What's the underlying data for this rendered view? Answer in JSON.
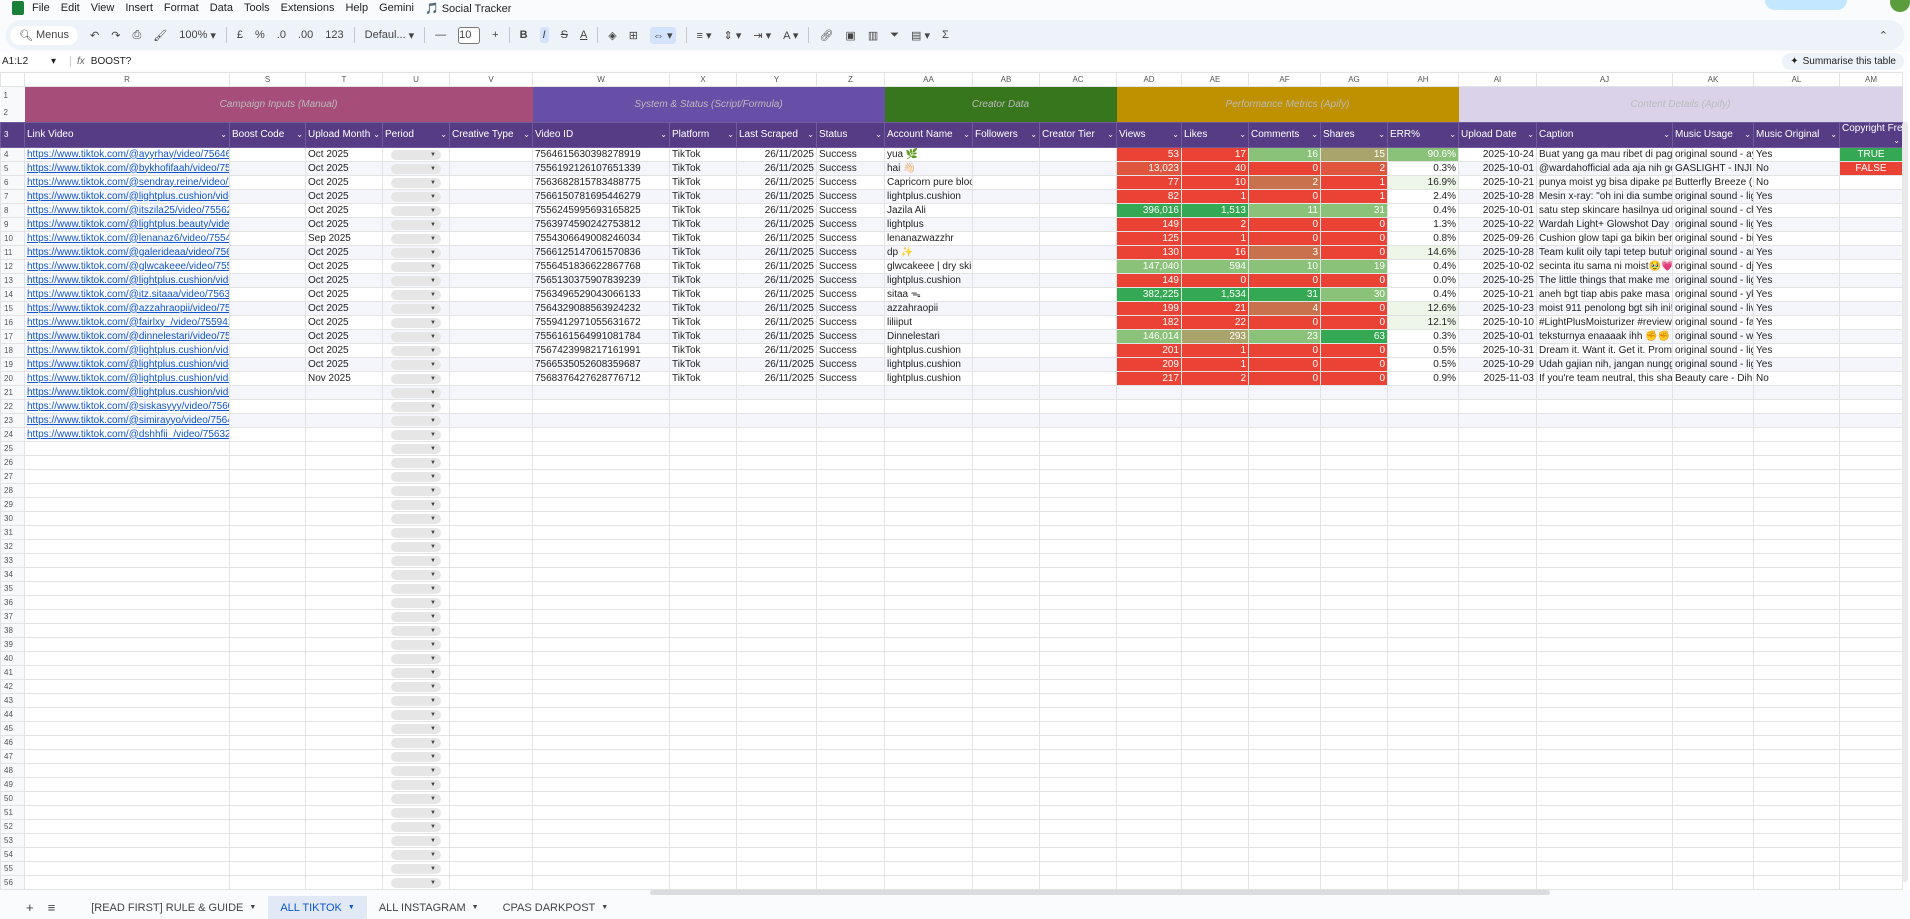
{
  "menu": [
    "File",
    "Edit",
    "View",
    "Insert",
    "Format",
    "Data",
    "Tools",
    "Extensions",
    "Help",
    "Gemini"
  ],
  "extension_menu": "🎵 Social Tracker",
  "toolbar": {
    "menus": "Menus",
    "zoom": "100%",
    "currency": "£",
    "percent": "%",
    "dec_less": ".0",
    "dec_more": ".00",
    "number_format": "123",
    "font": "Defaul...",
    "font_size": "10",
    "bold": "B",
    "italic": "I",
    "strike": "S",
    "text_color": "A",
    "sum": "Σ"
  },
  "formula": {
    "name_box": "A1:L2",
    "fx": "fx",
    "value": "BOOST?",
    "summarise": "Summarise this table"
  },
  "columns": [
    "R",
    "S",
    "T",
    "U",
    "V",
    "W",
    "X",
    "Y",
    "Z",
    "AA",
    "AB",
    "AC",
    "AD",
    "AE",
    "AF",
    "AG",
    "AH",
    "AI",
    "AJ",
    "AK",
    "AL",
    "AM"
  ],
  "bands": [
    {
      "label": "Campaign Inputs (Manual)",
      "color": "#a64d79",
      "span": 5
    },
    {
      "label": "System & Status (Script/Formula)",
      "color": "#674ea7",
      "span": 4
    },
    {
      "label": "Creator Data",
      "color": "#38761d",
      "span": 3
    },
    {
      "label": "Performance Metrics (Apify)",
      "color": "#bf9000",
      "span": 5
    },
    {
      "label": "Content Details (Apify)",
      "color": "#d9d2e9",
      "span": 5
    }
  ],
  "headers": [
    "Link Video",
    "Boost Code",
    "Upload Month",
    "Period",
    "Creative Type",
    "Video ID",
    "Platform",
    "Last Scraped",
    "Status",
    "Account Name",
    "Followers",
    "Creator Tier",
    "Views",
    "Likes",
    "Comments",
    "Shares",
    "ERR%",
    "Upload Date",
    "Caption",
    "Music Usage",
    "Music Original",
    "Copyright Free?"
  ],
  "scale_colors": {
    "R": "#ea4335",
    "O": "#e0553e",
    "B": "#c9714c",
    "OL": "#a8a46c",
    "LG": "#8bc27a",
    "G": "#34a853",
    "T": "#eef6ea",
    "W": "#ffffff"
  },
  "bool_colors": {
    "TRUE": "#34a853",
    "FALSE": "#ea4335"
  },
  "rows": [
    {
      "n": 4,
      "link": "https://www.tiktok.com/@ayyrhay/video/7564615",
      "month": "Oct 2025",
      "id": "7564615630398278919",
      "platform": "TikTok",
      "scraped": "26/11/2025",
      "status": "Success",
      "account": "yua 🌿",
      "views": "53",
      "likes": "17",
      "comments": "16",
      "shares": "15",
      "err": "90.6%",
      "c": [
        "R",
        "R",
        "LG",
        "OL",
        "LG"
      ],
      "date": "2025-10-24",
      "caption": "Buat yang ga mau ribet di pagi har",
      "music": "original sound - ayyr",
      "orig": "Yes",
      "copy": "TRUE"
    },
    {
      "n": 5,
      "link": "https://www.tiktok.com/@bykhofifaah/video/7556",
      "month": "Oct 2025",
      "id": "7556192126107651339",
      "platform": "TikTok",
      "scraped": "26/11/2025",
      "status": "Success",
      "account": "hai 👋🏻",
      "views": "13,023",
      "likes": "40",
      "comments": "0",
      "shares": "2",
      "err": "0.3%",
      "c": [
        "O",
        "R",
        "R",
        "O",
        "W"
      ],
      "date": "2025-10-01",
      "caption": "@wardahofficial ada aja nih gebra",
      "music": "GASLIGHT - INJI",
      "orig": "No",
      "copy": "FALSE"
    },
    {
      "n": 6,
      "link": "https://www.tiktok.com/@sendray.reine/video/756",
      "month": "Oct 2025",
      "id": "7563682815783488775",
      "platform": "TikTok",
      "scraped": "26/11/2025",
      "status": "Success",
      "account": "Capricorn pure blood",
      "views": "77",
      "likes": "10",
      "comments": "2",
      "shares": "1",
      "err": "16.9%",
      "c": [
        "R",
        "R",
        "B",
        "R",
        "T"
      ],
      "date": "2025-10-21",
      "caption": "punya moist yg bisa dipake pagi D",
      "music": "Butterfly Breeze (Lo",
      "orig": "No",
      "copy": ""
    },
    {
      "n": 7,
      "link": "https://www.tiktok.com/@lightplus.cushion/video/",
      "month": "Oct 2025",
      "id": "7566150781695446279",
      "platform": "TikTok",
      "scraped": "26/11/2025",
      "status": "Success",
      "account": "lightplus.cushion",
      "views": "82",
      "likes": "1",
      "comments": "0",
      "shares": "1",
      "err": "2.4%",
      "c": [
        "R",
        "R",
        "R",
        "R",
        "W"
      ],
      "date": "2025-10-28",
      "caption": "Mesin x-ray: \"oh ini dia sumber gla",
      "music": "original sound - ligh",
      "orig": "Yes",
      "copy": ""
    },
    {
      "n": 8,
      "link": "https://www.tiktok.com/@itszila25/video/755624",
      "month": "Oct 2025",
      "id": "7556245995693165825",
      "platform": "TikTok",
      "scraped": "26/11/2025",
      "status": "Success",
      "account": "Jazila Ali",
      "views": "396,016",
      "likes": "1,513",
      "comments": "11",
      "shares": "31",
      "err": "0.4%",
      "c": [
        "G",
        "G",
        "LG",
        "LG",
        "W"
      ],
      "date": "2025-10-01",
      "caption": "satu step skincare hasilnya udah k",
      "music": "original sound - che",
      "orig": "Yes",
      "copy": ""
    },
    {
      "n": 9,
      "link": "https://www.tiktok.com/@lightplus.beauty/video/7",
      "month": "Oct 2025",
      "id": "7563974590242753812",
      "platform": "TikTok",
      "scraped": "26/11/2025",
      "status": "Success",
      "account": "lightplus",
      "views": "149",
      "likes": "2",
      "comments": "0",
      "shares": "0",
      "err": "1.3%",
      "c": [
        "R",
        "R",
        "R",
        "R",
        "W"
      ],
      "date": "2025-10-22",
      "caption": "Wardah Light+ Glowshot Day Mois",
      "music": "original sound - ligh",
      "orig": "Yes",
      "copy": ""
    },
    {
      "n": 10,
      "link": "https://www.tiktok.com/@lenanaz6/video/755430",
      "month": "Sep 2025",
      "id": "7554306649008246034",
      "platform": "TikTok",
      "scraped": "26/11/2025",
      "status": "Success",
      "account": "lenanazwazzhr",
      "views": "125",
      "likes": "1",
      "comments": "0",
      "shares": "0",
      "err": "0.8%",
      "c": [
        "R",
        "R",
        "R",
        "R",
        "W"
      ],
      "date": "2025-09-26",
      "caption": "Cushion glow tapi ga bikin bermin",
      "music": "original sound - bizz",
      "orig": "Yes",
      "copy": ""
    },
    {
      "n": 11,
      "link": "https://www.tiktok.com/@galerideaa/video/75661",
      "month": "Oct 2025",
      "id": "7566125147061570836",
      "platform": "TikTok",
      "scraped": "26/11/2025",
      "status": "Success",
      "account": "dp ✨",
      "views": "130",
      "likes": "16",
      "comments": "3",
      "shares": "0",
      "err": "14.6%",
      "c": [
        "R",
        "R",
        "B",
        "R",
        "T"
      ],
      "date": "2025-10-28",
      "caption": "Team kulit oily tapi tetep butuh ler",
      "music": "original sound - arch",
      "orig": "Yes",
      "copy": ""
    },
    {
      "n": 12,
      "link": "https://www.tiktok.com/@glwcakeee/video/75564",
      "month": "Oct 2025",
      "id": "7556451836622867768",
      "platform": "TikTok",
      "scraped": "26/11/2025",
      "status": "Success",
      "account": "glwcakeee | dry skin",
      "views": "147,040",
      "likes": "594",
      "comments": "10",
      "shares": "19",
      "err": "0.4%",
      "c": [
        "LG",
        "LG",
        "LG",
        "LG",
        "W"
      ],
      "date": "2025-10-02",
      "caption": "secinta itu sama ni moist🥹💗 #l",
      "music": "original sound - djdi",
      "orig": "Yes",
      "copy": ""
    },
    {
      "n": 13,
      "link": "https://www.tiktok.com/@lightplus.cushion/video/",
      "month": "Oct 2025",
      "id": "7565130375907839239",
      "platform": "TikTok",
      "scraped": "26/11/2025",
      "status": "Success",
      "account": "lightplus.cushion",
      "views": "149",
      "likes": "0",
      "comments": "0",
      "shares": "0",
      "err": "0.0%",
      "c": [
        "R",
        "R",
        "R",
        "R",
        "W"
      ],
      "date": "2025-10-25",
      "caption": "The little things that make me feel",
      "music": "original sound - ligh",
      "orig": "Yes",
      "copy": ""
    },
    {
      "n": 14,
      "link": "https://www.tiktok.com/@itz.sitaaa/video/756349",
      "month": "Oct 2025",
      "id": "7563496529043066133",
      "platform": "TikTok",
      "scraped": "26/11/2025",
      "status": "Success",
      "account": "sitaa ᯓ",
      "views": "382,225",
      "likes": "1,534",
      "comments": "31",
      "shares": "30",
      "err": "0.4%",
      "c": [
        "G",
        "G",
        "G",
        "LG",
        "W"
      ],
      "date": "2025-10-21",
      "caption": "aneh bgt tiap abis pake masa kulit",
      "music": "original sound - ykz.",
      "orig": "Yes",
      "copy": ""
    },
    {
      "n": 15,
      "link": "https://www.tiktok.com/@azzahraopii/video/7564",
      "month": "Oct 2025",
      "id": "7564329088563924232",
      "platform": "TikTok",
      "scraped": "26/11/2025",
      "status": "Success",
      "account": "azzahraopii",
      "views": "199",
      "likes": "21",
      "comments": "4",
      "shares": "0",
      "err": "12.6%",
      "c": [
        "R",
        "R",
        "B",
        "R",
        "T"
      ],
      "date": "2025-10-23",
      "caption": "moist 911 penolong bgt sih ini! ga",
      "music": "original sound - livo",
      "orig": "Yes",
      "copy": ""
    },
    {
      "n": 16,
      "link": "https://www.tiktok.com/@fairlxy_/video/7559412",
      "month": "Oct 2025",
      "id": "7559412971055631672",
      "platform": "TikTok",
      "scraped": "26/11/2025",
      "status": "Success",
      "account": "liliiput",
      "views": "182",
      "likes": "22",
      "comments": "0",
      "shares": "0",
      "err": "12.1%",
      "c": [
        "R",
        "R",
        "R",
        "R",
        "T"
      ],
      "date": "2025-10-10",
      "caption": "#LightPlusMoisturizer  #reviewligh",
      "music": "original sound - fairl",
      "orig": "Yes",
      "copy": ""
    },
    {
      "n": 17,
      "link": "https://www.tiktok.com/@dinnelestari/video/7556",
      "month": "Oct 2025",
      "id": "7556161564991081784",
      "platform": "TikTok",
      "scraped": "26/11/2025",
      "status": "Success",
      "account": "Dinnelestari",
      "views": "146,014",
      "likes": "293",
      "comments": "23",
      "shares": "63",
      "err": "0.3%",
      "c": [
        "LG",
        "OL",
        "LG",
        "G",
        "W"
      ],
      "date": "2025-10-01",
      "caption": "teksturnya enaaaak ihh ✊✊ #Li",
      "music": "original sound - wtn",
      "orig": "Yes",
      "copy": ""
    },
    {
      "n": 18,
      "link": "https://www.tiktok.com/@lightplus.cushion/video/",
      "month": "Oct 2025",
      "id": "7567423998217161991",
      "platform": "TikTok",
      "scraped": "26/11/2025",
      "status": "Success",
      "account": "lightplus.cushion",
      "views": "201",
      "likes": "1",
      "comments": "0",
      "shares": "0",
      "err": "0.5%",
      "c": [
        "R",
        "R",
        "R",
        "R",
        "W"
      ],
      "date": "2025-10-31",
      "caption": "Dream it. Want it. Get it. Promo's h",
      "music": "original sound - ligh",
      "orig": "Yes",
      "copy": ""
    },
    {
      "n": 19,
      "link": "https://www.tiktok.com/@lightplus.cushion/video/",
      "month": "Oct 2025",
      "id": "7566535052608359687",
      "platform": "TikTok",
      "scraped": "26/11/2025",
      "status": "Success",
      "account": "lightplus.cushion",
      "views": "209",
      "likes": "1",
      "comments": "0",
      "shares": "0",
      "err": "0.5%",
      "c": [
        "R",
        "R",
        "R",
        "R",
        "W"
      ],
      "date": "2025-10-29",
      "caption": "Udah gajian nih, jangan nunggu na",
      "music": "original sound - ligh",
      "orig": "Yes",
      "copy": ""
    },
    {
      "n": 20,
      "link": "https://www.tiktok.com/@lightplus.cushion/video/",
      "month": "Nov 2025",
      "id": "7568376427628776712",
      "platform": "TikTok",
      "scraped": "26/11/2025",
      "status": "Success",
      "account": "lightplus.cushion",
      "views": "217",
      "likes": "2",
      "comments": "0",
      "shares": "0",
      "err": "0.9%",
      "c": [
        "R",
        "R",
        "R",
        "R",
        "W"
      ],
      "date": "2025-11-03",
      "caption": "If you're team neutral, this shade's",
      "music": "Beauty care - Dih",
      "orig": "No",
      "copy": ""
    },
    {
      "n": 21,
      "link": "https://www.tiktok.com/@lightplus.cushion/video/"
    },
    {
      "n": 22,
      "link": "https://www.tiktok.com/@siskasyyy/video/756061"
    },
    {
      "n": 23,
      "link": "https://www.tiktok.com/@simirayyo/video/756434"
    },
    {
      "n": 24,
      "link": "https://www.tiktok.com/@dshhfii_/video/7563243"
    }
  ],
  "last_row": 57,
  "tabs": [
    {
      "label": "[READ FIRST] RULE & GUIDE",
      "selected": false
    },
    {
      "label": "ALL TIKTOK",
      "selected": true
    },
    {
      "label": "ALL INSTAGRAM",
      "selected": false
    },
    {
      "label": "CPAS DARKPOST",
      "selected": false
    }
  ]
}
